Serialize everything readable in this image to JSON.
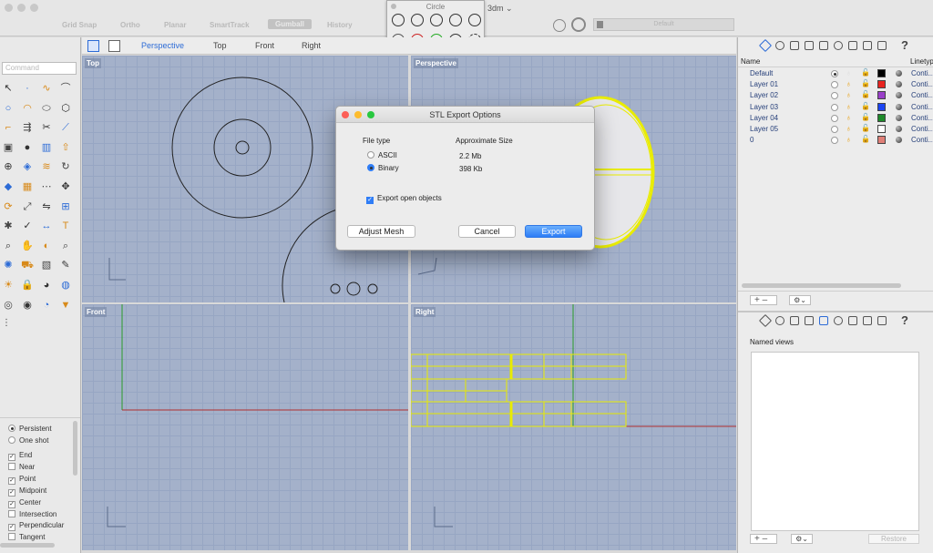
{
  "app": {
    "document_name": "3dm"
  },
  "snaps": [
    "Grid Snap",
    "Ortho",
    "Planar",
    "SmartTrack",
    "Gumball",
    "History"
  ],
  "snap_active": "Gumball",
  "display_mode": "Default",
  "circle_popup": {
    "title": "Circle"
  },
  "command": {
    "placeholder": "Command"
  },
  "viewport_tabs": [
    "Perspective",
    "Top",
    "Front",
    "Right"
  ],
  "viewports": {
    "top": "Top",
    "perspective": "Perspective",
    "front": "Front",
    "right": "Right"
  },
  "osnap": {
    "mode_options": [
      {
        "label": "Persistent",
        "selected": true
      },
      {
        "label": "One shot",
        "selected": false
      }
    ],
    "snaps": [
      {
        "label": "End",
        "checked": true
      },
      {
        "label": "Near",
        "checked": false
      },
      {
        "label": "Point",
        "checked": true
      },
      {
        "label": "Midpoint",
        "checked": true
      },
      {
        "label": "Center",
        "checked": true
      },
      {
        "label": "Intersection",
        "checked": false
      },
      {
        "label": "Perpendicular",
        "checked": true
      },
      {
        "label": "Tangent",
        "checked": false
      }
    ]
  },
  "layers": {
    "header_name": "Name",
    "header_linetype": "Linetyp",
    "rows": [
      {
        "name": "Default",
        "color": "#000000",
        "linetype": "Conti...",
        "current": true
      },
      {
        "name": "Layer 01",
        "color": "#e8231f",
        "linetype": "Conti...",
        "current": false
      },
      {
        "name": "Layer 02",
        "color": "#9a3fc9",
        "linetype": "Conti...",
        "current": false
      },
      {
        "name": "Layer 03",
        "color": "#1b45f2",
        "linetype": "Conti...",
        "current": false
      },
      {
        "name": "Layer 04",
        "color": "#1e8a2a",
        "linetype": "Conti...",
        "current": false
      },
      {
        "name": "Layer 05",
        "color": "#ffffff",
        "linetype": "Conti...",
        "current": false
      },
      {
        "name": "0",
        "color": "#e07f77",
        "linetype": "Conti...",
        "current": false
      }
    ]
  },
  "named_views": {
    "label": "Named views",
    "restore": "Restore"
  },
  "dialog": {
    "title": "STL Export Options",
    "file_type_label": "File type",
    "size_label": "Approximate Size",
    "options": [
      {
        "label": "ASCII",
        "size": "2.2 Mb",
        "selected": false
      },
      {
        "label": "Binary",
        "size": "398 Kb",
        "selected": true
      }
    ],
    "export_open_label": "Export open objects",
    "export_open_checked": true,
    "adjust_mesh": "Adjust Mesh",
    "cancel": "Cancel",
    "export": "Export"
  }
}
